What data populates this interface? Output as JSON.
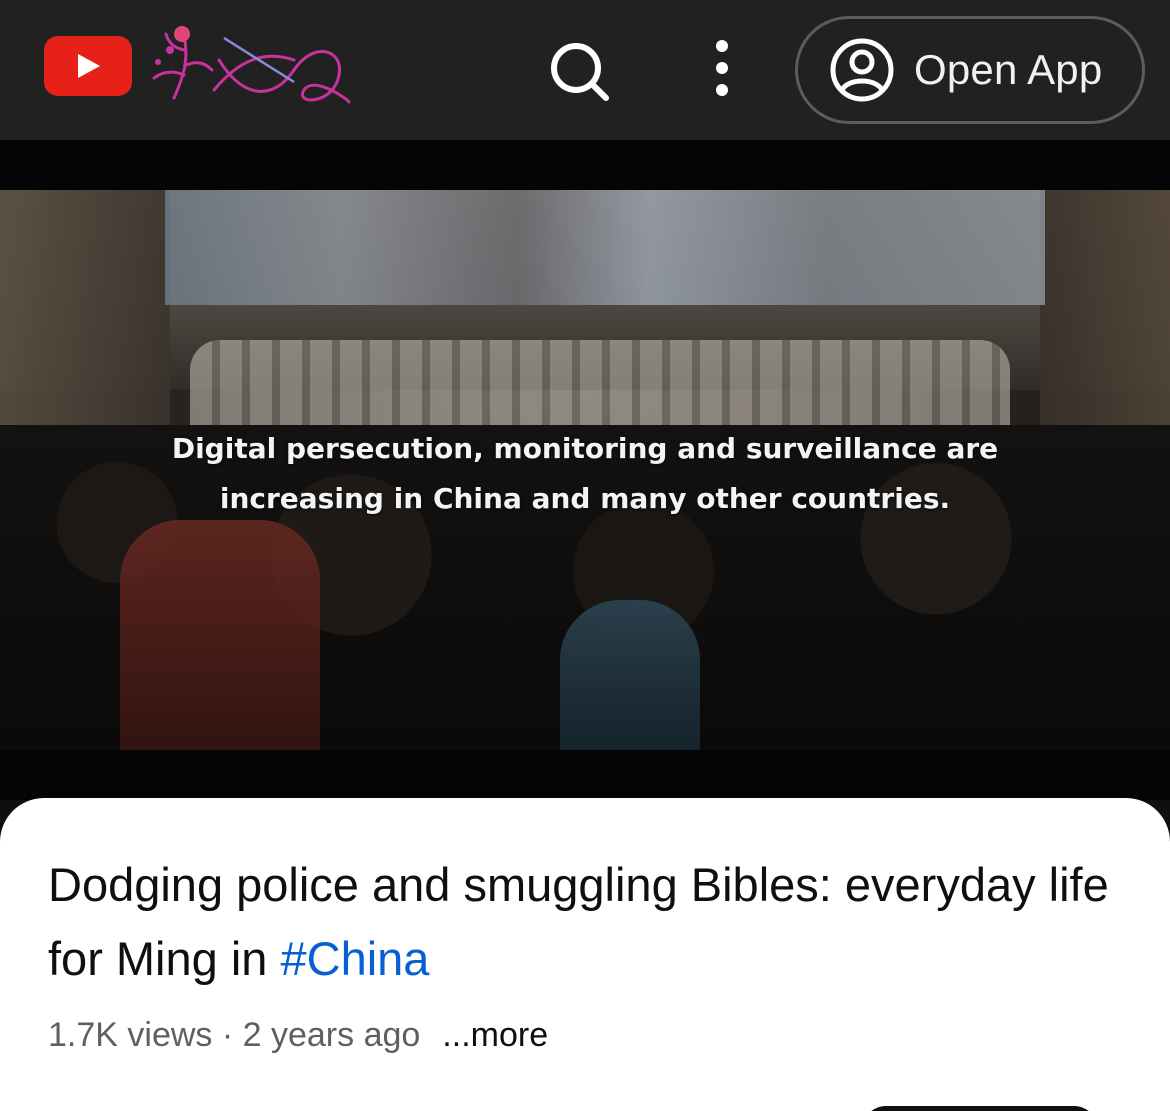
{
  "header": {
    "logo_icon": "youtube-play-icon",
    "search_icon": "search-icon",
    "menu_icon": "more-vertical-icon",
    "open_app_label": "Open App",
    "open_app_icon": "account-circle-icon"
  },
  "video": {
    "caption_line1": "Digital persecution, monitoring and surveillance are",
    "caption_line2": "increasing in China and many other countries."
  },
  "details": {
    "title_text": "Dodging police and smuggling Bibles: everyday life for Ming in ",
    "title_hashtag": "#China",
    "views": "1.7K views",
    "separator": " · ",
    "age": "2 years ago",
    "more": "...more"
  },
  "colors": {
    "topbar": "#212121",
    "youtube_red": "#e62117",
    "hashtag_blue": "#065fd4",
    "meta_gray": "#606060"
  }
}
